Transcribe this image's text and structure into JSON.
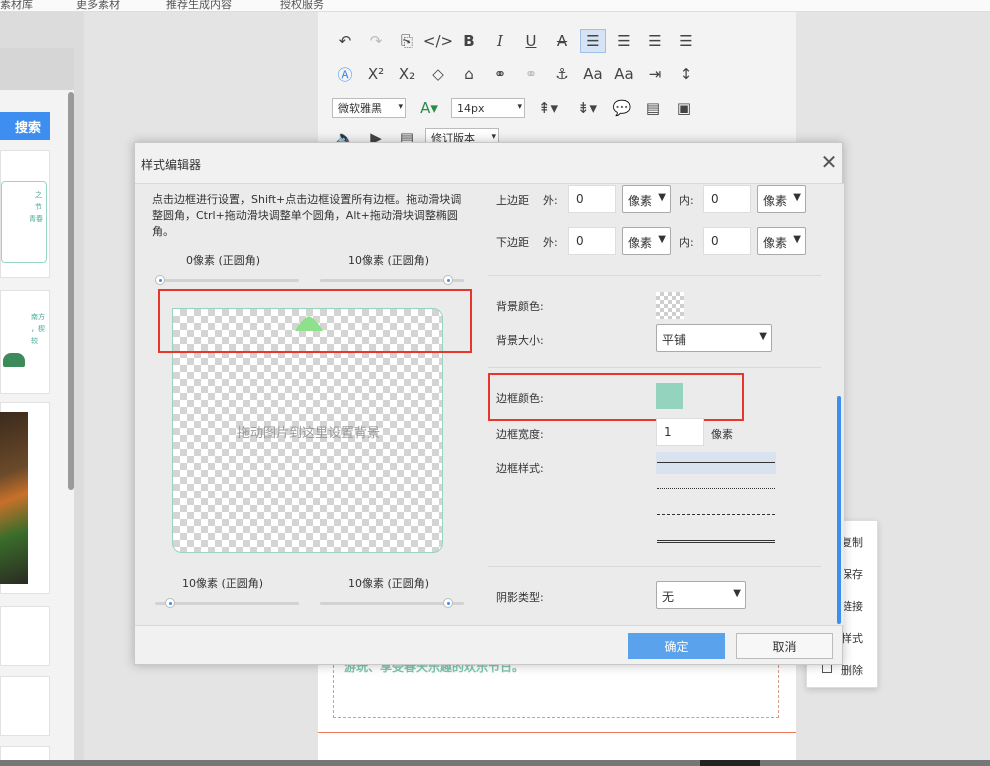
{
  "background": {
    "top_tabs": [
      "素材库",
      "更多素材",
      "推荐生成内容",
      "授权服务"
    ],
    "search_label": "搜索",
    "card_texts": [
      "之",
      "节",
      "青春"
    ],
    "card2_texts": [
      "南方",
      "，楔",
      "较"
    ],
    "doc_text": "游玩、享受春天乐趣的欢乐节日。"
  },
  "toolbar": {
    "font_family": "微软雅黑",
    "font_size": "14px",
    "revision_label": "修订版本"
  },
  "context_menu": {
    "items": [
      "复制",
      "保存",
      "链接",
      "样式",
      "删除"
    ]
  },
  "dialog": {
    "title": "样式编辑器",
    "hint": "点击边框进行设置，Shift+点击边框设置所有边框。拖动滑块调整圆角，Ctrl+拖动滑块调整单个圆角，Alt+拖动滑块调整椭圆角。",
    "radius_top_left": "0像素 (正圆角)",
    "radius_top_right": "10像素 (正圆角)",
    "radius_bottom_left": "10像素 (正圆角)",
    "radius_bottom_right": "10像素 (正圆角)",
    "drop_hint": "拖动图片到这里设置背景",
    "margin_top_label": "上边距",
    "margin_bottom_label": "下边距",
    "outer_label": "外:",
    "inner_label": "内:",
    "margin_top_outer": "0",
    "margin_top_inner": "0",
    "margin_bottom_outer": "0",
    "margin_bottom_inner": "0",
    "unit_select": "像素",
    "bg_color_label": "背景颜色:",
    "bg_size_label": "背景大小:",
    "bg_size_value": "平铺",
    "border_color_label": "边框颜色:",
    "border_color": "#94d3bd",
    "border_width_label": "边框宽度:",
    "border_width_value": "1",
    "border_width_unit": "像素",
    "border_style_label": "边框样式:",
    "shadow_label": "阴影类型:",
    "shadow_value": "无",
    "ok_label": "确定",
    "cancel_label": "取消",
    "accent_color": "#3d8ef0",
    "highlight_color": "#e8372a"
  }
}
